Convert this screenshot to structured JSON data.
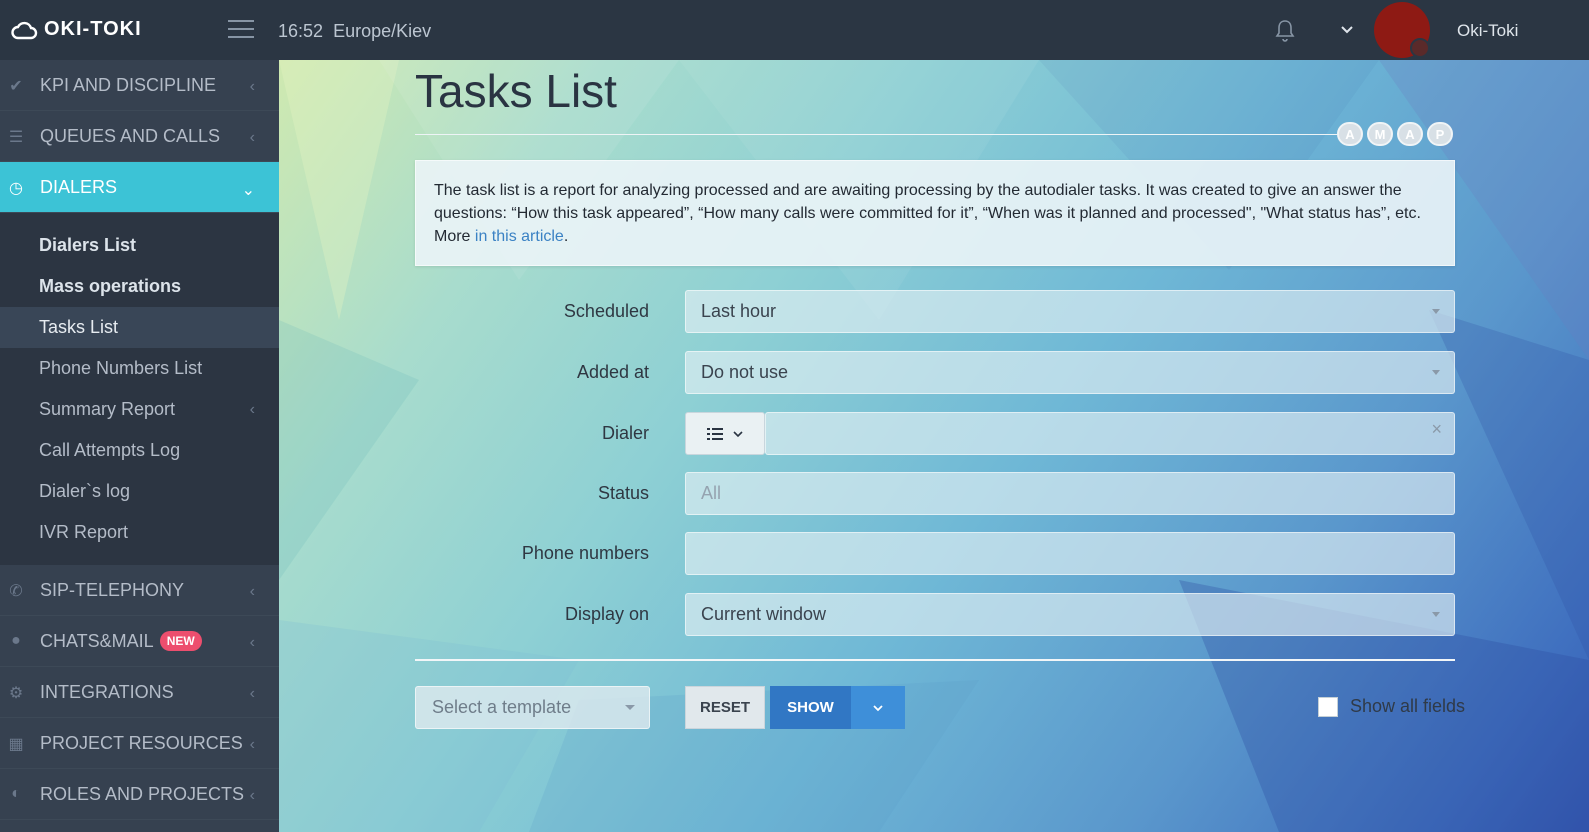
{
  "app": {
    "logo_text": "OKI-TOKI",
    "time": "16:52",
    "timezone": "Europe/Kiev",
    "username": "Oki-Toki"
  },
  "sidebar": {
    "top_items": [
      {
        "label": "KPI AND DISCIPLINE",
        "icon": "check-icon"
      },
      {
        "label": "QUEUES AND CALLS",
        "icon": "list-icon"
      },
      {
        "label": "DIALERS",
        "icon": "clock-icon"
      }
    ],
    "dialers_submenu": [
      {
        "label": "Dialers List"
      },
      {
        "label": "Mass operations"
      },
      {
        "label": "Tasks List"
      },
      {
        "label": "Phone Numbers List"
      },
      {
        "label": "Summary Report"
      },
      {
        "label": "Call Attempts Log"
      },
      {
        "label": "Dialer`s log"
      },
      {
        "label": "IVR Report"
      }
    ],
    "bottom_items": [
      {
        "label": "SIP-TELEPHONY",
        "icon": "phone-icon"
      },
      {
        "label": "CHATS&MAIL",
        "icon": "chat-icon",
        "badge": "NEW"
      },
      {
        "label": "INTEGRATIONS",
        "icon": "gears-icon"
      },
      {
        "label": "PROJECT RESOURCES",
        "icon": "grid-icon"
      },
      {
        "label": "ROLES AND PROJECTS",
        "icon": "toggle-icon"
      }
    ]
  },
  "page": {
    "title": "Tasks List",
    "access_pills": [
      "A",
      "M",
      "A",
      "P"
    ],
    "info_text": "The task list is a report for analyzing processed and are awaiting processing by the autodialer tasks. It was created to give an answer the questions: “How this task appeared”, “How many calls were committed for it”, “When was it planned and processed\", \"What status has”, etc. More ",
    "info_link": "in this article",
    "info_end": "."
  },
  "filters": {
    "scheduled": {
      "label": "Scheduled",
      "value": "Last hour"
    },
    "added_at": {
      "label": "Added at",
      "value": "Do not use"
    },
    "dialer": {
      "label": "Dialer",
      "value": ""
    },
    "status": {
      "label": "Status",
      "placeholder": "All"
    },
    "phone_numbers": {
      "label": "Phone numbers",
      "value": ""
    },
    "display_on": {
      "label": "Display on",
      "value": "Current window"
    }
  },
  "actions": {
    "template_placeholder": "Select a template",
    "reset_label": "RESET",
    "show_label": "SHOW",
    "show_all_fields_label": "Show all fields"
  },
  "colors": {
    "topbar": "#2b3643",
    "sidebar": "#364150",
    "active": "#3cc3d6",
    "primary": "#3177c4",
    "badge": "#ed4e6e"
  }
}
